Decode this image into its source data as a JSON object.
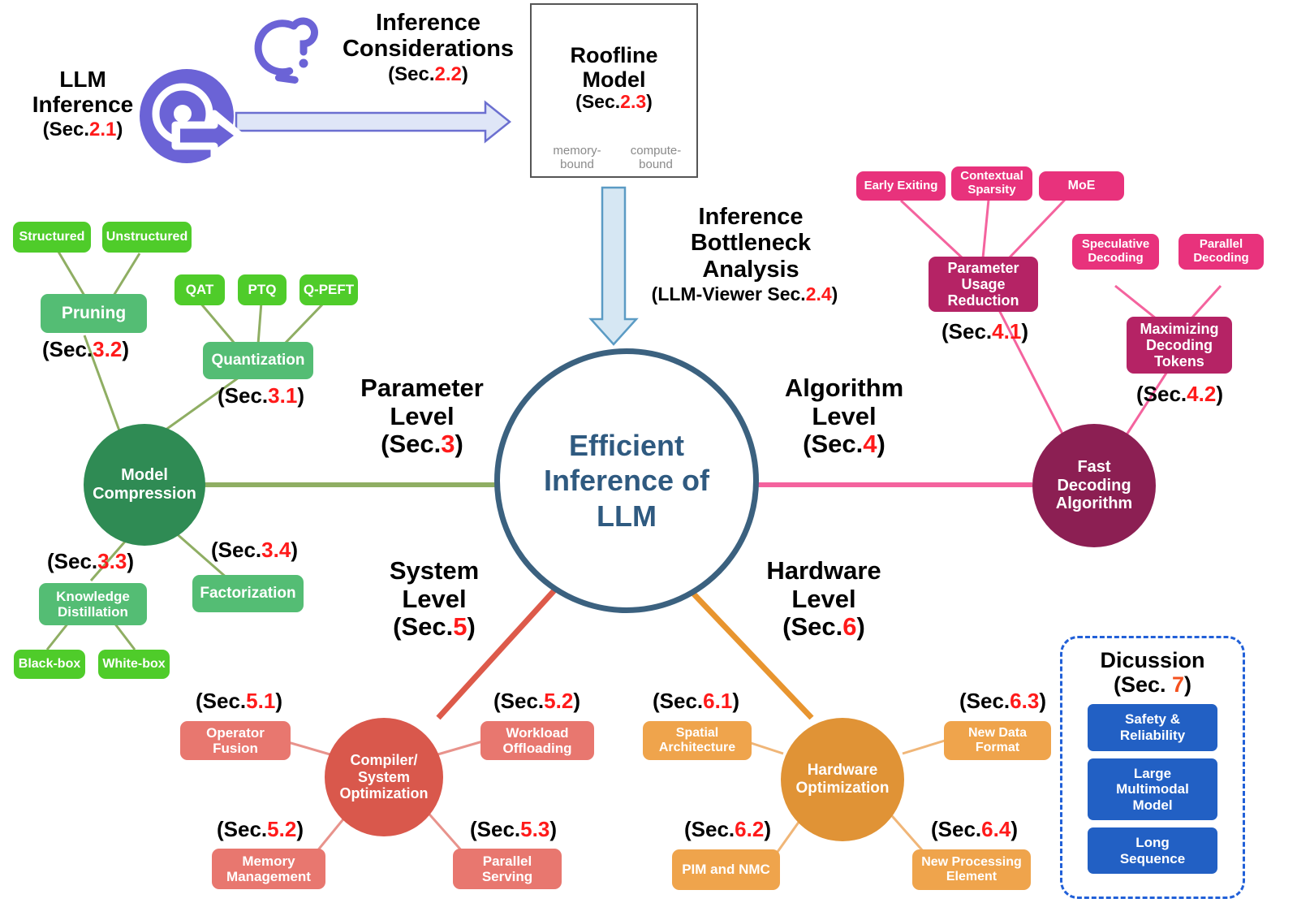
{
  "colors": {
    "green_leaf": "#4fcc2a",
    "green_mid": "#54bd74",
    "green_hub": "#2f8b54",
    "pink_leaf": "#e8327c",
    "pink_mid": "#b52365",
    "pink_hub": "#8c1f53",
    "red_leaf": "#e8776f",
    "red_hub": "#d9584c",
    "orange_leaf": "#efa44c",
    "orange_hub": "#e09336",
    "blue_leaf": "#2260c4",
    "center_stroke": "#3b617f",
    "center_text": "#2f5a80",
    "icon_purple": "#6b63d6",
    "section_number": "#ff1a1a",
    "discussion_border": "#2160d8"
  },
  "center": {
    "line1": "Efficient",
    "line2": "Inference of",
    "line3": "LLM"
  },
  "intro": {
    "llm_inference": {
      "line1": "LLM",
      "line2": "Inference",
      "sec_prefix": "(Sec.",
      "sec_num": "2.1",
      "sec_suffix": ")"
    },
    "considerations": {
      "line1": "Inference",
      "line2": "Considerations",
      "sec_prefix": "(Sec.",
      "sec_num": "2.2",
      "sec_suffix": ")"
    },
    "roofline": {
      "line1": "Roofline",
      "line2": "Model",
      "sec_prefix": "(Sec.",
      "sec_num": "2.3",
      "sec_suffix": ")",
      "memory_bound": "memory-\nbound",
      "compute_bound": "compute-\nbound"
    },
    "bottleneck": {
      "line1": "Inference",
      "line2": "Bottleneck",
      "line3": "Analysis",
      "sec_prefix": "(LLM-Viewer Sec.",
      "sec_num": "2.4",
      "sec_suffix": ")"
    }
  },
  "branches": {
    "parameter": {
      "line1": "Parameter",
      "line2": "Level",
      "sec_prefix": "(Sec.",
      "sec_num": "3",
      "sec_suffix": ")"
    },
    "algorithm": {
      "line1": "Algorithm",
      "line2": "Level",
      "sec_prefix": "(Sec.",
      "sec_num": "4",
      "sec_suffix": ")"
    },
    "system": {
      "line1": "System",
      "line2": "Level",
      "sec_prefix": "(Sec.",
      "sec_num": "5",
      "sec_suffix": ")"
    },
    "hardware": {
      "line1": "Hardware",
      "line2": "Level",
      "sec_prefix": "(Sec.",
      "sec_num": "6",
      "sec_suffix": ")"
    }
  },
  "model_compression": {
    "hub": {
      "line1": "Model",
      "line2": "Compression"
    },
    "pruning": {
      "label": "Pruning",
      "sec_prefix": "(Sec.",
      "sec_num": "3.2",
      "sec_suffix": ")"
    },
    "pruning_children": [
      "Structured",
      "Unstructured"
    ],
    "quantization": {
      "label": "Quantization",
      "sec_prefix": "(Sec.",
      "sec_num": "3.1",
      "sec_suffix": ")"
    },
    "quantization_children": [
      "QAT",
      "PTQ",
      "Q-PEFT"
    ],
    "distillation": {
      "line1": "Knowledge",
      "line2": "Distillation",
      "sec_prefix": "(Sec.",
      "sec_num": "3.3",
      "sec_suffix": ")"
    },
    "distillation_children": [
      "Black-box",
      "White-box"
    ],
    "factorization": {
      "label": "Factorization",
      "sec_prefix": "(Sec.",
      "sec_num": "3.4",
      "sec_suffix": ")"
    }
  },
  "fast_decoding": {
    "hub": {
      "line1": "Fast",
      "line2": "Decoding",
      "line3": "Algorithm"
    },
    "param_usage": {
      "line1": "Parameter",
      "line2": "Usage",
      "line3": "Reduction",
      "sec_prefix": "(Sec.",
      "sec_num": "4.1",
      "sec_suffix": ")"
    },
    "param_usage_children": [
      "Early Exiting",
      "Contextual\nSparsity",
      "MoE"
    ],
    "max_tokens": {
      "line1": "Maximizing",
      "line2": "Decoding",
      "line3": "Tokens",
      "sec_prefix": "(Sec.",
      "sec_num": "4.2",
      "sec_suffix": ")"
    },
    "max_tokens_children": [
      "Speculative\nDecoding",
      "Parallel\nDecoding"
    ]
  },
  "compiler_system": {
    "hub": {
      "line1": "Compiler/",
      "line2": "System",
      "line3": "Optimization"
    },
    "children": [
      {
        "label": "Operator\nFusion",
        "sec_prefix": "(Sec.",
        "sec_num": "5.1",
        "sec_suffix": ")"
      },
      {
        "label": "Workload\nOffloading",
        "sec_prefix": "(Sec.",
        "sec_num": "5.2",
        "sec_suffix": ")"
      },
      {
        "label": "Memory\nManagement",
        "sec_prefix": "(Sec.",
        "sec_num": "5.2",
        "sec_suffix": ")"
      },
      {
        "label": "Parallel\nServing",
        "sec_prefix": "(Sec.",
        "sec_num": "5.3",
        "sec_suffix": ")"
      }
    ]
  },
  "hardware_opt": {
    "hub": {
      "line1": "Hardware",
      "line2": "Optimization"
    },
    "children": [
      {
        "label": "Spatial\nArchitecture",
        "sec_prefix": "(Sec.",
        "sec_num": "6.1",
        "sec_suffix": ")"
      },
      {
        "label": "New Data\nFormat",
        "sec_prefix": "(Sec.",
        "sec_num": "6.3",
        "sec_suffix": ")"
      },
      {
        "label": "PIM and NMC",
        "sec_prefix": "(Sec.",
        "sec_num": "6.2",
        "sec_suffix": ")"
      },
      {
        "label": "New Processing\nElement",
        "sec_prefix": "(Sec.",
        "sec_num": "6.4",
        "sec_suffix": ")"
      }
    ]
  },
  "discussion": {
    "title_line1": "Dicussion",
    "title_prefix": "(Sec. ",
    "title_num": "7",
    "title_suffix": ")",
    "items": [
      "Safety &\nReliability",
      "Large\nMultimodal\nModel",
      "Long\nSequence"
    ]
  },
  "icons": {
    "llm_inference_icon": "inference-engine-icon",
    "question_bubble_icon": "speech-bubble-question-icon",
    "flow_arrow_right": "arrow-right-icon",
    "flow_arrow_down": "arrow-down-icon"
  }
}
